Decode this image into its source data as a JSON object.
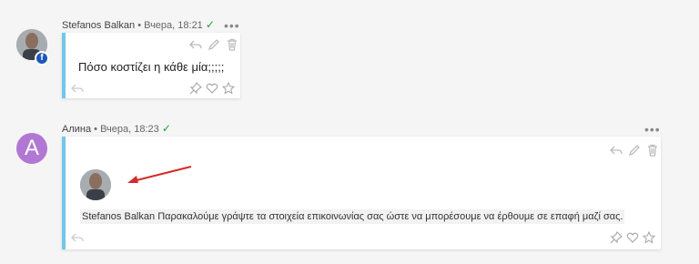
{
  "messages": [
    {
      "author": "Stefanos Balkan",
      "separator": "•",
      "timestamp": "Вчера, 18:21",
      "status_icon": "check-icon",
      "more_label": "•••",
      "text": "Πόσο κοστίζει η κάθε μία;;;;;",
      "avatar_type": "photo",
      "badge": "f",
      "badge_icon": "facebook-icon"
    },
    {
      "author": "Алина",
      "separator": "•",
      "timestamp": "Вчера, 18:23",
      "status_icon": "check-icon",
      "more_label": "•••",
      "avatar_letter": "A",
      "mention_name": "Stefanos Balkan",
      "text": "Παρακαλούμε γράψτε τα στοιχεία επικοινωνίας σας ώστε να μπορέσουμε να έρθουμε σε επαφή μαζί σας."
    }
  ],
  "colors": {
    "accent_bar": "#73c6ea",
    "letter_avatar_bg": "#b077d3",
    "check_green": "#1aa23a",
    "annotation_arrow": "#d42a2a",
    "facebook_blue": "#1c57b8"
  }
}
